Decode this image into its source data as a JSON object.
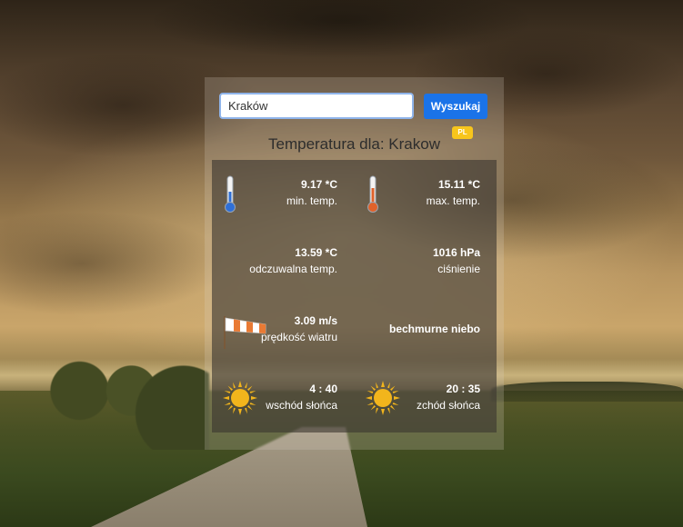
{
  "search": {
    "value": "Kraków",
    "button_label": "Wyszukaj"
  },
  "title": "Temperatura dla: Krakow",
  "country_badge": "PL",
  "weather": {
    "min_temp": {
      "value": "9.17 *C",
      "label": "min. temp.",
      "icon": "thermometer-cold-icon"
    },
    "max_temp": {
      "value": "15.11 *C",
      "label": "max. temp.",
      "icon": "thermometer-hot-icon"
    },
    "feels_like": {
      "value": "13.59 *C",
      "label": "odczuwalna temp."
    },
    "pressure": {
      "value": "1016 hPa",
      "label": "ciśnienie"
    },
    "wind": {
      "value": "3.09 m/s",
      "label": "prędkość wiatru",
      "icon": "windsock-icon"
    },
    "description": {
      "label": "bechmurne niebo"
    },
    "sunrise": {
      "value": "4 : 40",
      "label": "wschód słońca",
      "icon": "sun-icon"
    },
    "sunset": {
      "value": "20 : 35",
      "label": "zchód słońca",
      "icon": "sun-icon"
    }
  },
  "colors": {
    "accent": "#1a73e8",
    "badge": "#f7c51c",
    "thermometer_cold": "#2f6fd6",
    "thermometer_hot": "#e0622a",
    "sun": "#f2b51c"
  }
}
